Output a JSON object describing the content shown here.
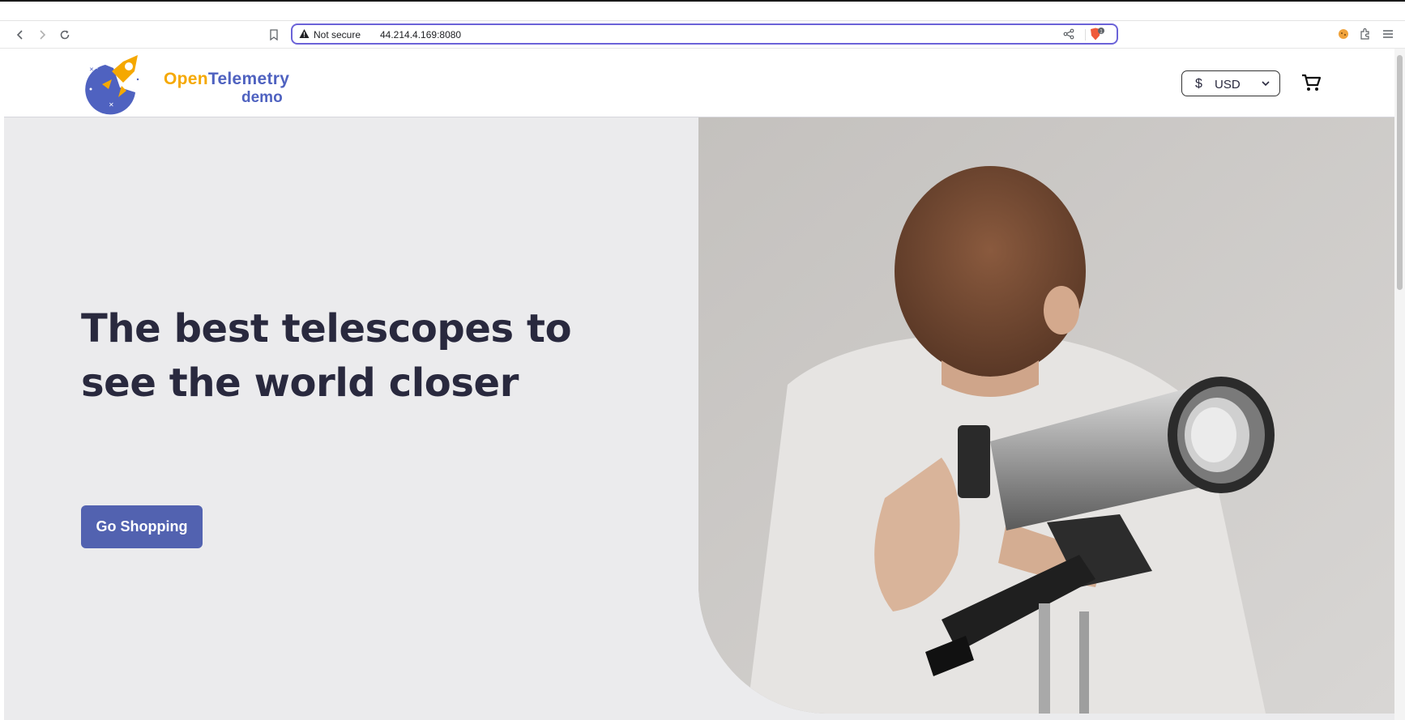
{
  "browser": {
    "security_label": "Not secure",
    "url": "44.214.4.169:8080",
    "shield_count": "1"
  },
  "site": {
    "logo_word_1": "Open",
    "logo_word_2": "Telemetry",
    "logo_word_3": "demo",
    "currency_symbol": "$",
    "currency_code": "USD"
  },
  "hero": {
    "headline": "The best telescopes to see the world closer",
    "cta_label": "Go Shopping"
  },
  "colors": {
    "brand_blue": "#4f62c0",
    "brand_orange": "#f5a800",
    "cta": "#5262b0",
    "heading": "#29293e",
    "hero_bg": "#ebebed"
  }
}
